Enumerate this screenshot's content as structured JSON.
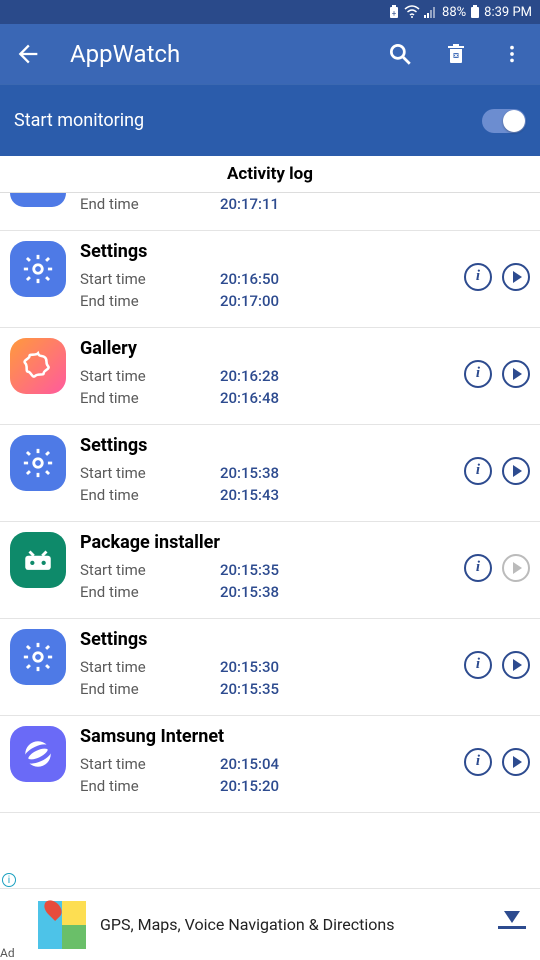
{
  "status": {
    "battery": "88%",
    "time": "8:39 PM"
  },
  "app": {
    "title": "AppWatch"
  },
  "banner": {
    "label": "Start monitoring",
    "toggle_on": true
  },
  "section": {
    "title": "Activity log"
  },
  "labels": {
    "start": "Start time",
    "end": "End time"
  },
  "entries": [
    {
      "name": "",
      "start": "",
      "end": "20:17:11",
      "icon": "settings",
      "partial": true,
      "play_enabled": true
    },
    {
      "name": "Settings",
      "start": "20:16:50",
      "end": "20:17:00",
      "icon": "settings",
      "play_enabled": true
    },
    {
      "name": "Gallery",
      "start": "20:16:28",
      "end": "20:16:48",
      "icon": "gallery",
      "play_enabled": true
    },
    {
      "name": "Settings",
      "start": "20:15:38",
      "end": "20:15:43",
      "icon": "settings",
      "play_enabled": true
    },
    {
      "name": "Package installer",
      "start": "20:15:35",
      "end": "20:15:38",
      "icon": "pkg",
      "play_enabled": false
    },
    {
      "name": "Settings",
      "start": "20:15:30",
      "end": "20:15:35",
      "icon": "settings",
      "play_enabled": true
    },
    {
      "name": "Samsung Internet",
      "start": "20:15:04",
      "end": "20:15:20",
      "icon": "sbrowser",
      "play_enabled": true
    }
  ],
  "ad": {
    "text": "GPS, Maps, Voice Navigation & Directions",
    "badge": "Ad"
  }
}
